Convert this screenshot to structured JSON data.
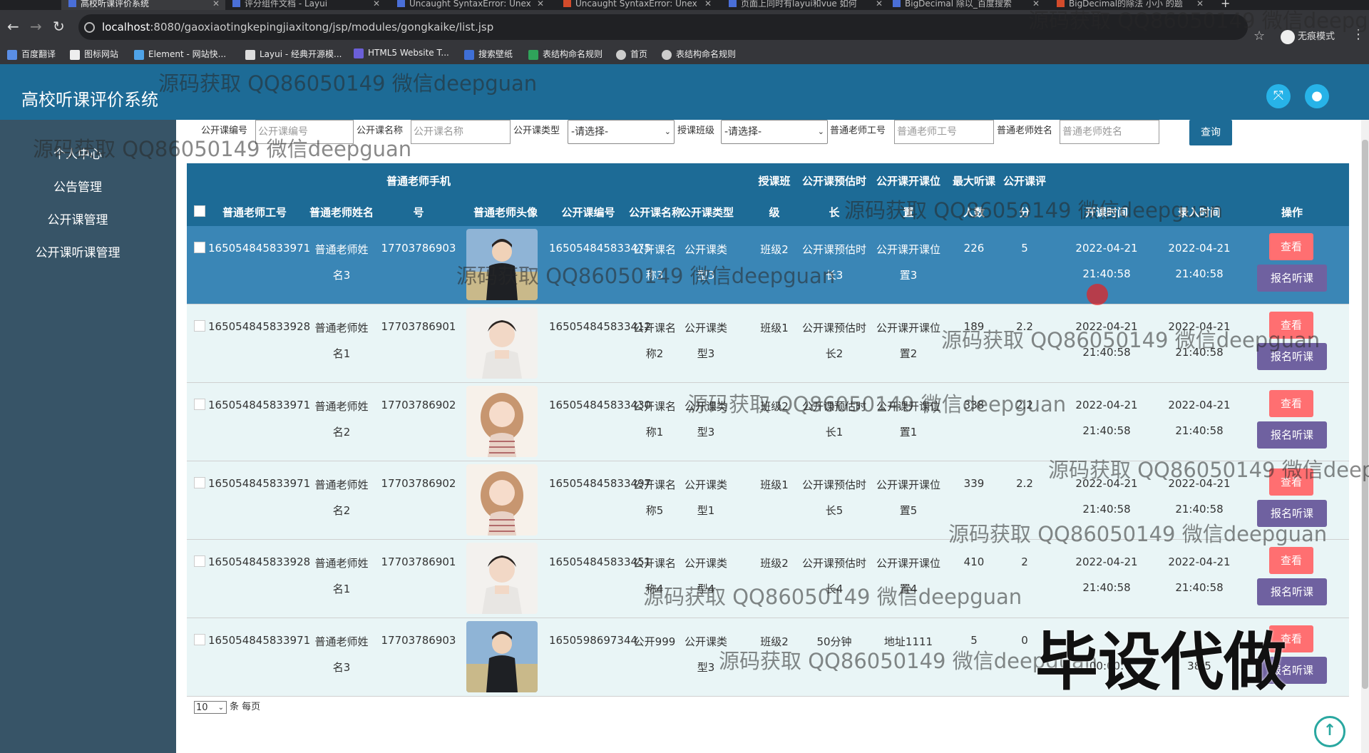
{
  "browser": {
    "tabs": [
      {
        "label": "高校听课评价系统",
        "active": true
      },
      {
        "label": "评分组件文档 - Layui"
      },
      {
        "label": "Uncaught SyntaxError: Unex"
      },
      {
        "label": "Uncaught SyntaxError: Unex"
      },
      {
        "label": "页面上同时有layui和vue 如何"
      },
      {
        "label": "BigDecimal 除以_百度搜索"
      },
      {
        "label": "BigDecimal的除法 小小 的题"
      }
    ],
    "url_host": "localhost",
    "url_path": ":8080/gaoxiaotingkepingjiaxitong/jsp/modules/gongkaike/list.jsp",
    "incognito_label": "无痕模式",
    "bookmarks": [
      "百度翻译",
      "图标网站",
      "Element - 网站快...",
      "Layui - 经典开源模...",
      "HTML5 Website T...",
      "搜索壁纸",
      "表结构命名规则",
      "首页",
      "表结构命名规则"
    ]
  },
  "app": {
    "title": "高校听课评价系统",
    "sidebar": [
      "个人中心",
      "公告管理",
      "公开课管理",
      "公开课听课管理"
    ]
  },
  "search": {
    "fields": [
      {
        "label": "公开课编号",
        "placeholder": "公开课编号"
      },
      {
        "label": "公开课名称",
        "placeholder": "公开课名称"
      },
      {
        "label": "公开课类型",
        "value": "-请选择-"
      },
      {
        "label": "授课班级",
        "value": "-请选择-"
      },
      {
        "label": "普通老师工号",
        "placeholder": "普通老师工号"
      },
      {
        "label": "普通老师姓名",
        "placeholder": "普通老师姓名"
      }
    ],
    "button": "查询"
  },
  "table": {
    "headers": {
      "teacher_id": "普通老师工号",
      "teacher_name": "普通老师姓名",
      "phone_top": "普通老师手机",
      "phone_bottom": "号",
      "avatar": "普通老师头像",
      "course_no": "公开课编号",
      "course_name": "公开课名称",
      "course_type": "公开课类型",
      "class_top": "授课班",
      "class_bottom": "级",
      "duration_top": "公开课预估时",
      "duration_bottom": "长",
      "location_top": "公开课开课位",
      "location_bottom": "置",
      "capacity_top": "最大听课",
      "capacity_bottom": "人数",
      "score_top": "公开课评",
      "score_bottom": "分",
      "start_time": "开课时间",
      "entry_time": "录入时间",
      "actions": "操作"
    },
    "rows": [
      {
        "teacher_id": "165054845833971",
        "name1": "普通老师姓",
        "name2": "名3",
        "phone": "17703786903",
        "course_no": "165054845833475",
        "cname1": "公开课名",
        "cname2": "称3",
        "ctype1": "公开课类",
        "ctype2": "型3",
        "class": "班级2",
        "dur1": "公开课预估时",
        "dur2": "长3",
        "loc1": "公开课开课位",
        "loc2": "置3",
        "capacity": "226",
        "score": "5",
        "start1": "2022-04-21",
        "start2": "21:40:58",
        "entry1": "2022-04-21",
        "entry2": "21:40:58",
        "avatar": "male"
      },
      {
        "teacher_id": "165054845833928",
        "name1": "普通老师姓",
        "name2": "名1",
        "phone": "17703786901",
        "course_no": "165054845833412",
        "cname1": "公开课名",
        "cname2": "称2",
        "ctype1": "公开课类",
        "ctype2": "型3",
        "class": "班级1",
        "dur1": "公开课预估时",
        "dur2": "长2",
        "loc1": "公开课开课位",
        "loc2": "置2",
        "capacity": "189",
        "score": "2.2",
        "start1": "2022-04-21",
        "start2": "21:40:58",
        "entry1": "2022-04-21",
        "entry2": "21:40:58",
        "avatar": "male2"
      },
      {
        "teacher_id": "165054845833971",
        "name1": "普通老师姓",
        "name2": "名2",
        "phone": "17703786902",
        "course_no": "165054845833430",
        "cname1": "公开课名",
        "cname2": "称1",
        "ctype1": "公开课类",
        "ctype2": "型3",
        "class": "班级2",
        "dur1": "公开课预估时",
        "dur2": "长1",
        "loc1": "公开课开课位",
        "loc2": "置1",
        "capacity": "338",
        "score": "2.2",
        "start1": "2022-04-21",
        "start2": "21:40:58",
        "entry1": "2022-04-21",
        "entry2": "21:40:58",
        "avatar": "female"
      },
      {
        "teacher_id": "165054845833971",
        "name1": "普通老师姓",
        "name2": "名2",
        "phone": "17703786902",
        "course_no": "165054845833497",
        "cname1": "公开课名",
        "cname2": "称5",
        "ctype1": "公开课类",
        "ctype2": "型1",
        "class": "班级1",
        "dur1": "公开课预估时",
        "dur2": "长5",
        "loc1": "公开课开课位",
        "loc2": "置5",
        "capacity": "339",
        "score": "2.2",
        "start1": "2022-04-21",
        "start2": "21:40:58",
        "entry1": "2022-04-21",
        "entry2": "21:40:58",
        "avatar": "female"
      },
      {
        "teacher_id": "165054845833928",
        "name1": "普通老师姓",
        "name2": "名1",
        "phone": "17703786901",
        "course_no": "165054845833451",
        "cname1": "公开课名",
        "cname2": "称4",
        "ctype1": "公开课类",
        "ctype2": "型4",
        "class": "班级2",
        "dur1": "公开课预估时",
        "dur2": "长4",
        "loc1": "公开课开课位",
        "loc2": "置4",
        "capacity": "410",
        "score": "2",
        "start1": "2022-04-21",
        "start2": "21:40:58",
        "entry1": "2022-04-21",
        "entry2": "21:40:58",
        "avatar": "male2"
      },
      {
        "teacher_id": "165054845833971",
        "name1": "普通老师姓",
        "name2": "名3",
        "phone": "17703786903",
        "course_no": "1650598697344",
        "cname1": "公开999",
        "cname2": "",
        "ctype1": "公开课类",
        "ctype2": "型3",
        "class": "班级2",
        "dur1": "50分钟",
        "dur2": "",
        "loc1": "地址1111",
        "loc2": "",
        "capacity": "5",
        "score": "0",
        "start1": "",
        "start2": "00:00:",
        "entry1": "",
        "entry2": "38:5",
        "avatar": "male"
      }
    ],
    "view_label": "查看",
    "apply_label": "报名听课"
  },
  "pager": {
    "page_size": "10",
    "suffix": "条 每页"
  },
  "watermarks": {
    "qq": "源码获取 QQ86050149 微信deepguan",
    "big": "毕设代做"
  },
  "colors": {
    "header": "#1d6b96",
    "sidebar": "#375467",
    "view_button": "#ff6f71",
    "apply_button": "#6f61a0",
    "selected_row": "#3a86b6",
    "row_bg": "#e9f5f6"
  }
}
